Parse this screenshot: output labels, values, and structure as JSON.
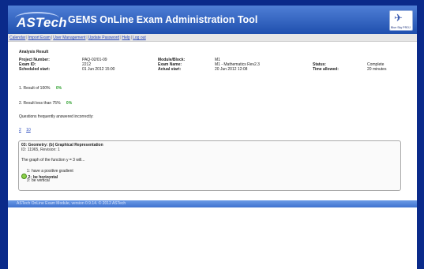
{
  "header": {
    "logo_text": "ASTech",
    "title": "GEMS OnLine Exam Administration Tool",
    "partner_logo_text": "Blue Sky PROJ"
  },
  "nav": [
    {
      "label": "Calendar"
    },
    {
      "label": "Import Exam"
    },
    {
      "label": "User Management"
    },
    {
      "label": "Update Password"
    },
    {
      "label": "Help"
    },
    {
      "label": "Log out"
    }
  ],
  "section_title": "Analysis Result",
  "details": {
    "project_number_label": "Project Number:",
    "project_number": "PAQ-02/01-09",
    "exam_id_label": "Exam ID:",
    "exam_id": "2212",
    "scheduled_start_label": "Scheduled start:",
    "scheduled_start": "01 Jun 2012 15:00",
    "module_block_label": "Module/Block:",
    "module_block": "M1",
    "exam_name_label": "Exam Name:",
    "exam_name": "M1 - Mathematics Rev2.3",
    "actual_start_label": "Actual start:",
    "actual_start": "20 Jun 2012 12:08",
    "status_label": "Status:",
    "status": "Complete",
    "time_allowed_label": "Time allowed:",
    "time_allowed": "20 minutes"
  },
  "results": {
    "r1_label": "1. Result of 100%",
    "r1_value": "0%",
    "r2_label": "2. Result less than 75%",
    "r2_value": "0%"
  },
  "frequent_label": "Questions frequently answered incorrectly:",
  "frequent_links": [
    "2",
    "10"
  ],
  "question": {
    "title": "03: Geometry: (b) Graphical Representation",
    "id_line": "ID: 11965, Revision: 1",
    "text": "The graph of the function y = 3 will...",
    "answers": [
      {
        "num": "1:",
        "text": "have a positive gradient",
        "correct": false
      },
      {
        "num": "2:",
        "text": "be horizontal",
        "correct": true
      },
      {
        "num": "3:",
        "text": "be vertical",
        "correct": false
      }
    ]
  },
  "footer": "ASTech OnLine Exam Module, version 0.9.14. © 2012 ASTech",
  "colors": {
    "background": "#0a2a8a",
    "header": "#2f5fbe",
    "link": "#2244bb",
    "percent_green": "#2ea02e"
  }
}
